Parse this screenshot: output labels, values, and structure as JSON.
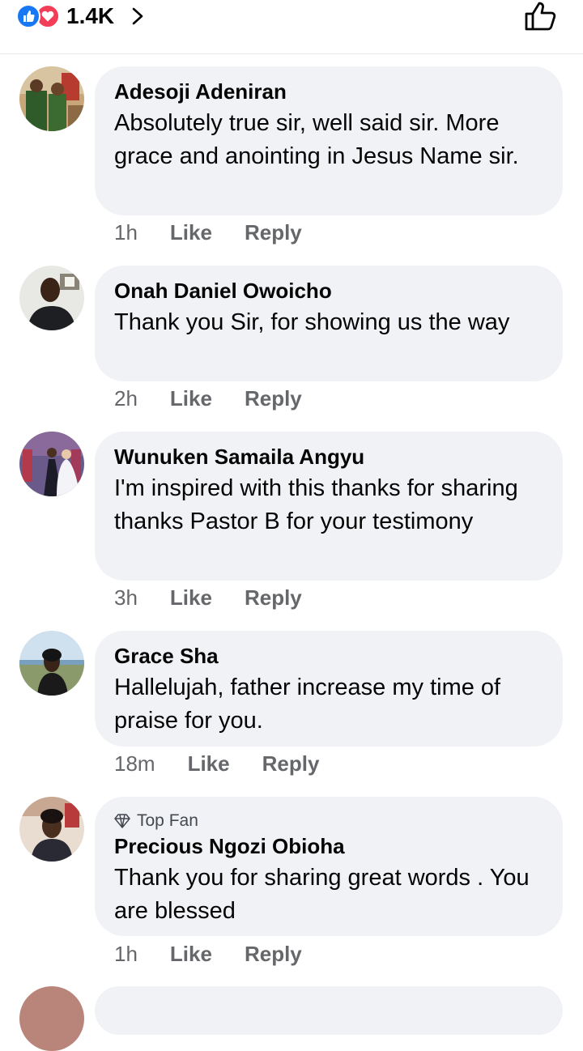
{
  "header": {
    "reaction_count": "1.4K",
    "reaction_icons": [
      "like-icon",
      "love-icon"
    ],
    "like_button_icon": "thumbs-up-outline-icon"
  },
  "comments": [
    {
      "author": "Adesoji Adeniran",
      "top_fan_label": "",
      "text": "Absolutely true sir, well said sir. More grace and anointing in Jesus Name sir.",
      "time": "1h",
      "like": "Like",
      "reply": "Reply"
    },
    {
      "author": "Onah Daniel Owoicho",
      "top_fan_label": "",
      "text": "Thank you Sir, for showing us the way",
      "time": "2h",
      "like": "Like",
      "reply": "Reply"
    },
    {
      "author": "Wunuken Samaila Angyu",
      "top_fan_label": "",
      "text": "I'm inspired with this thanks for sharing thanks Pastor B for your testimony",
      "time": "3h",
      "like": "Like",
      "reply": "Reply"
    },
    {
      "author": "Grace Sha",
      "top_fan_label": "",
      "text": "Hallelujah, father increase my time of praise for you.",
      "time": "18m",
      "like": "Like",
      "reply": "Reply"
    },
    {
      "author": "Precious Ngozi Obioha",
      "top_fan_label": "Top Fan",
      "text": "Thank you for sharing great words . You are blessed",
      "time": "1h",
      "like": "Like",
      "reply": "Reply"
    }
  ],
  "colors": {
    "like_blue": "#1877f2",
    "love_red": "#f33e58",
    "bubble_bg": "#f0f2f5",
    "secondary_text": "#65676b"
  }
}
